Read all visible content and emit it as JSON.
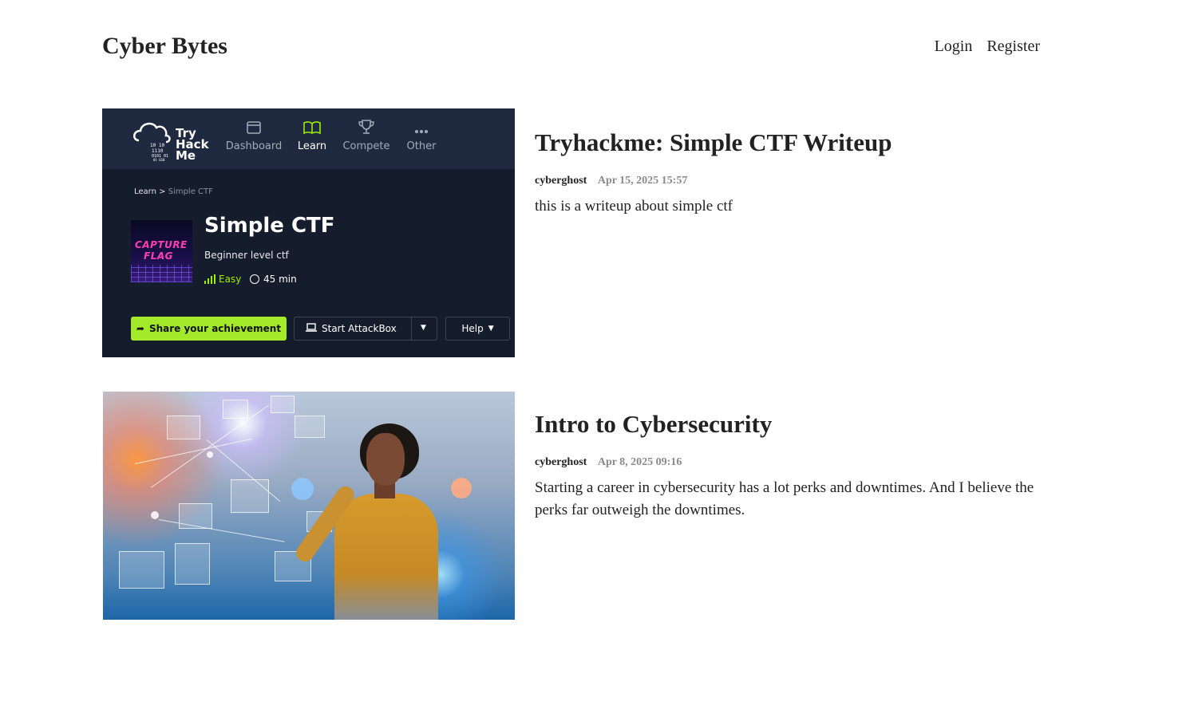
{
  "site": {
    "logo": "Cyber Bytes",
    "nav": {
      "login": "Login",
      "register": "Register"
    }
  },
  "posts": [
    {
      "title": "Tryhackme: Simple CTF Writeup",
      "author": "cyberghost",
      "date": "Apr 15, 2025 15:57",
      "excerpt": "this is a writeup about simple ctf",
      "thumbnail": {
        "brand": [
          "Try",
          "Hack",
          "Me"
        ],
        "nav": [
          {
            "label": "Dashboard",
            "icon": "window-icon"
          },
          {
            "label": "Learn",
            "icon": "book-icon",
            "active": true
          },
          {
            "label": "Compete",
            "icon": "trophy-icon"
          },
          {
            "label": "Other",
            "icon": "ellipsis-icon"
          }
        ],
        "breadcrumb": {
          "root": "Learn",
          "sep": ">",
          "current": "Simple CTF"
        },
        "room_art": {
          "line1": "CAPTURE",
          "line2": "FLAG"
        },
        "room_title": "Simple CTF",
        "room_desc": "Beginner level ctf",
        "difficulty": "Easy",
        "duration": "45 min",
        "buttons": {
          "share": "Share your achievement",
          "attack": "Start AttackBox",
          "help": "Help"
        },
        "colors": {
          "accent": "#9fef00",
          "bg": "#151c2b",
          "topbar": "#1f2a40"
        }
      }
    },
    {
      "title": "Intro to Cybersecurity",
      "author": "cyberghost",
      "date": "Apr 8, 2025 09:16",
      "excerpt": "Starting a career in cybersecurity has a lot perks and downtimes. And I believe the perks far outweigh the downtimes."
    }
  ]
}
